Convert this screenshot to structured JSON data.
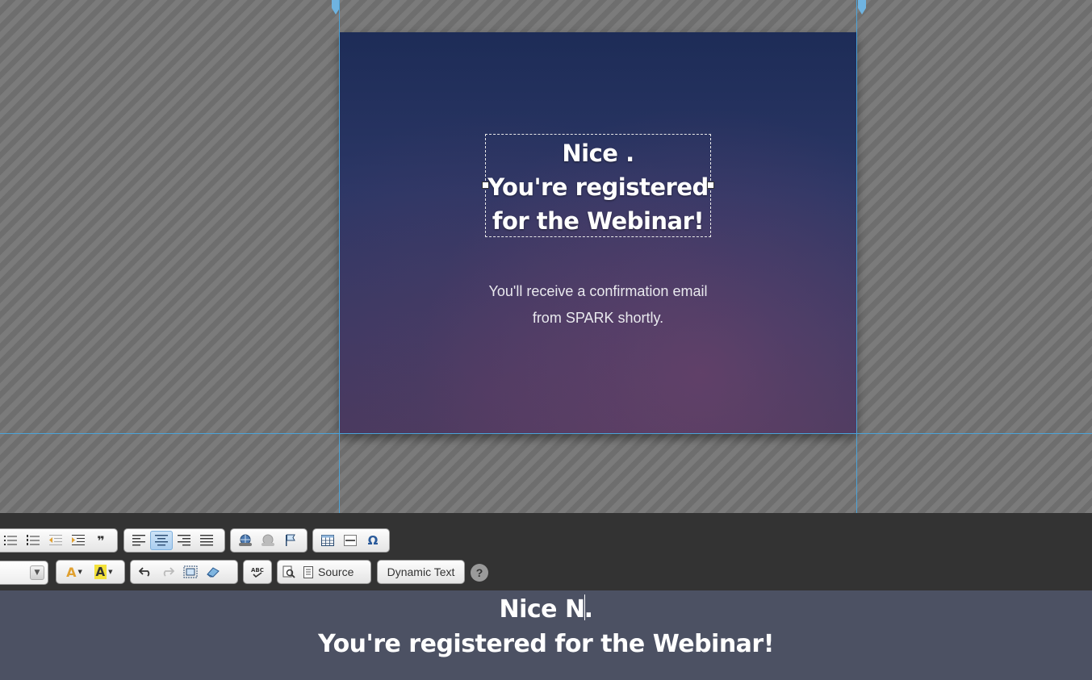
{
  "canvas": {
    "headline_lines": [
      "Nice .",
      "You're registered",
      "for the Webinar!"
    ],
    "subtext_lines": [
      "You'll receive a confirmation email",
      "from SPARK shortly."
    ],
    "guide_color": "#4ba3d9"
  },
  "toolbar": {
    "row1": {
      "list_group": [
        "bulleted-list-icon",
        "numbered-list-icon",
        "outdent-icon",
        "indent-icon",
        "blockquote-icon"
      ],
      "align_group": [
        "align-left-icon",
        "align-center-icon",
        "align-right-icon",
        "justify-icon"
      ],
      "align_active": "align-center-icon",
      "link_group": [
        "link-icon",
        "unlink-icon",
        "anchor-flag-icon"
      ],
      "insert_group": [
        "table-icon",
        "horizontal-rule-icon",
        "special-char-icon"
      ],
      "special_char_glyph": "Ω",
      "blockquote_glyph": "❞"
    },
    "row2": {
      "text_color_glyph": "A",
      "bg_color_glyph": "A",
      "source_label": "Source",
      "dynamic_text_label": "Dynamic Text",
      "help_glyph": "?"
    },
    "accent_color": "#a9cdef"
  },
  "editor": {
    "line1_before_caret": "Nice N",
    "line1_after_caret": ".",
    "line2": "You're registered for the Webinar!"
  }
}
